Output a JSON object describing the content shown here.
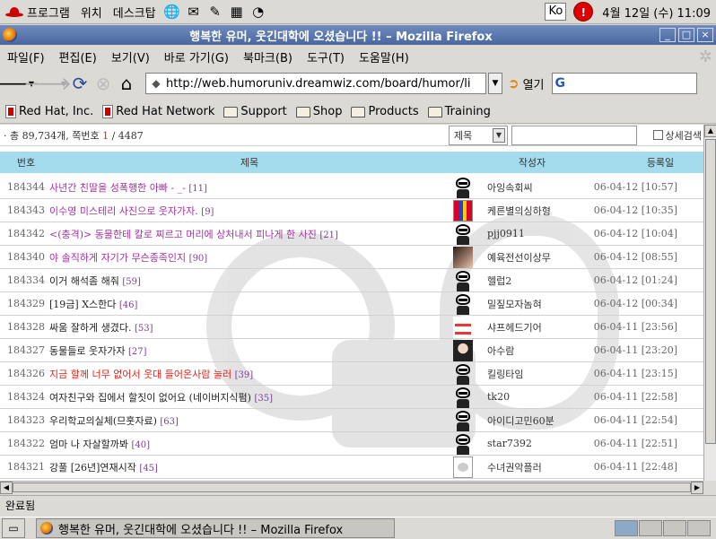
{
  "top_panel": {
    "app_menu": "프로그램",
    "places": "위치",
    "desktop": "데스크탑",
    "launchers": [
      "globe-icon",
      "notes-icon",
      "writer-icon",
      "calc-icon",
      "presentation-icon"
    ],
    "kbd_indicator": "Ko",
    "alert_icon": "!",
    "clock": "4월 12일 (수) 11:09"
  },
  "window": {
    "title": "행복한 유머, 웃긴대학에 오셨습니다 !! – Mozilla Firefox",
    "min": "_",
    "max": "□",
    "close": "×"
  },
  "menubar": [
    "파일(F)",
    "편집(E)",
    "보기(V)",
    "바로 가기(G)",
    "북마크(B)",
    "도구(T)",
    "도움말(H)"
  ],
  "toolbar": {
    "url": "http://web.humoruniv.dreamwiz.com/board/humor/list.htm",
    "go_label": "열기",
    "search_badge": "G",
    "search_placeholder": ""
  },
  "bookmarks": [
    {
      "label": "Red Hat, Inc.",
      "type": "page"
    },
    {
      "label": "Red Hat Network",
      "type": "page"
    },
    {
      "label": "Support",
      "type": "folder"
    },
    {
      "label": "Shop",
      "type": "folder"
    },
    {
      "label": "Products",
      "type": "folder"
    },
    {
      "label": "Training",
      "type": "folder"
    }
  ],
  "board": {
    "count_prefix": "· 총 89,734개, 쪽번호 ",
    "page_current": "1",
    "page_sep": " / 4487",
    "search_select": "제목",
    "detail_search": "상세검색",
    "headers": {
      "num": "번호",
      "title": "제목",
      "author": "작성자",
      "date": "등록일"
    },
    "rows": [
      {
        "num": "184344",
        "title": "사년간 친딸을 성폭행한 아빠 - _-",
        "comments": "[11]",
        "color": "purple",
        "author": "아잉속회씨",
        "avatar": "mask",
        "date": "06-04-12 [10:57]"
      },
      {
        "num": "184343",
        "title": "이수영 미스테리 사진으로 웃자가자.",
        "comments": "[9]",
        "color": "purple",
        "author": "케른별의싱하형",
        "avatar": "group",
        "date": "06-04-12 [10:35]"
      },
      {
        "num": "184342",
        "title": "<(충격)> 동물한테 칼로 찌르고 머리에 상처내서 피나게 한 사진",
        "comments": "[21]",
        "color": "purple",
        "author": "pjj0911",
        "avatar": "mask",
        "date": "06-04-12 [10:04]"
      },
      {
        "num": "184340",
        "title": "야 솔직하게 자기가 무슨종족인지",
        "comments": "[90]",
        "color": "purple",
        "author": "예육전선이상무",
        "avatar": "photo",
        "date": "06-04-12 [08:55]"
      },
      {
        "num": "184334",
        "title": "이거 해석좀 해줘",
        "comments": "[59]",
        "color": "black",
        "author": "헬럽2",
        "avatar": "mask",
        "date": "06-04-12 [01:24]"
      },
      {
        "num": "184329",
        "title": "[19금] X스한다",
        "comments": "[46]",
        "color": "black",
        "author": "밀짚모자놈혀",
        "avatar": "mask",
        "date": "06-04-12 [00:34]"
      },
      {
        "num": "184328",
        "title": "싸움 잘하게 생겼다.",
        "comments": "[53]",
        "color": "black",
        "author": "샤프헤드기어",
        "avatar": "tie",
        "date": "06-04-11 [23:56]"
      },
      {
        "num": "184327",
        "title": "동물들로 웃자가자",
        "comments": "[27]",
        "color": "black",
        "author": "아수람",
        "avatar": "face",
        "date": "06-04-11 [23:20]"
      },
      {
        "num": "184326",
        "title": "지금 할께 너무 없어서 웃대 들어온사람 눌러",
        "comments": "[39]",
        "color": "red",
        "author": "킬링타임",
        "avatar": "mask",
        "date": "06-04-11 [23:15]"
      },
      {
        "num": "184324",
        "title": "여자친구와 집에서 할짓이 없어요 (네이버지식펌)",
        "comments": "[35]",
        "color": "black",
        "author": "tk20",
        "avatar": "mask",
        "date": "06-04-11 [22:58]"
      },
      {
        "num": "184323",
        "title": "우리학교의실체(므훗자료)",
        "comments": "[63]",
        "color": "black",
        "author": "아이디고민60분",
        "avatar": "mask",
        "date": "06-04-11 [22:54]"
      },
      {
        "num": "184322",
        "title": "엄마 나 자살할까봐",
        "comments": "[40]",
        "color": "black",
        "author": "star7392",
        "avatar": "mask",
        "date": "06-04-11 [22:51]"
      },
      {
        "num": "184321",
        "title": "강풀 [26년]연재시작",
        "comments": "[45]",
        "color": "black",
        "author": "수녀권악플러",
        "avatar": "cat",
        "date": "06-04-11 [22:48]"
      }
    ]
  },
  "status": "완료됨",
  "taskbar": {
    "task_title": "행복한 유머, 웃긴대학에 오셨습니다 !! – Mozilla Firefox",
    "workspaces": 4
  }
}
